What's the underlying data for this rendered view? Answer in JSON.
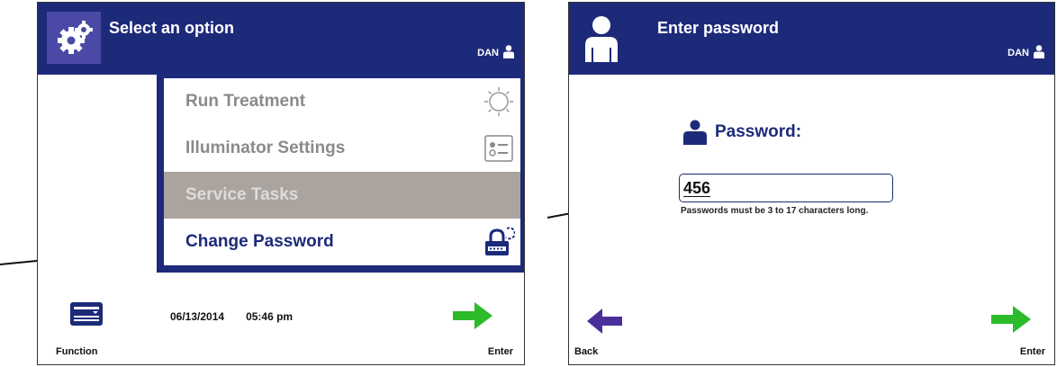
{
  "left_screen": {
    "title": "Select an option",
    "user": "DAN",
    "menu": [
      {
        "label": "Run Treatment",
        "icon": "sun-icon",
        "state": "disabled"
      },
      {
        "label": "Illuminator Settings",
        "icon": "settings-list-icon",
        "state": "disabled"
      },
      {
        "label": "Service Tasks",
        "icon": "",
        "state": "greyed"
      },
      {
        "label": "Change Password",
        "icon": "padlock-refresh-icon",
        "state": "enabled"
      }
    ],
    "date": "06/13/2014",
    "time": "05:46 pm",
    "function_label": "Function",
    "enter_label": "Enter"
  },
  "right_screen": {
    "title": "Enter password",
    "user": "DAN",
    "password_label": "Password:",
    "password_value": "456",
    "hint": "Passwords must be 3 to 17 characters long.",
    "back_label": "Back",
    "enter_label": "Enter"
  },
  "colors": {
    "header": "#1d2a7a",
    "enter_arrow": "#2bbb2b",
    "back_arrow": "#4a2f9a",
    "disabled_text": "#8a8a8a",
    "service_bg": "#aaa39e"
  }
}
